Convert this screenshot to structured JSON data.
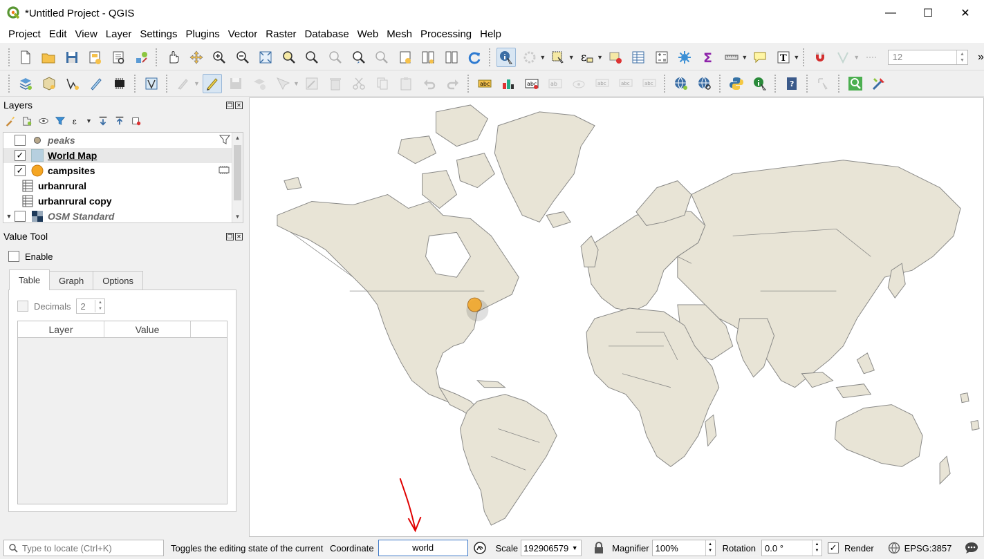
{
  "window": {
    "title": "*Untitled Project - QGIS",
    "minimize": "—",
    "maximize": "☐",
    "close": "✕"
  },
  "menubar": {
    "items": [
      "Project",
      "Edit",
      "View",
      "Layer",
      "Settings",
      "Plugins",
      "Vector",
      "Raster",
      "Database",
      "Web",
      "Mesh",
      "Processing",
      "Help"
    ]
  },
  "toolbar": {
    "font_size_value": "12",
    "overflow": "»"
  },
  "layers_panel": {
    "title": "Layers",
    "layers": [
      {
        "name": "peaks",
        "checked": false,
        "style": "italic",
        "icon": "point-icon"
      },
      {
        "name": "World Map",
        "checked": true,
        "style": "underline",
        "icon": "polygon-icon"
      },
      {
        "name": "campsites",
        "checked": true,
        "style": "normal",
        "icon": "orange-point-icon"
      },
      {
        "name": "urbanrural",
        "checked": null,
        "style": "normal",
        "icon": "table-icon"
      },
      {
        "name": "urbanrural copy",
        "checked": null,
        "style": "normal",
        "icon": "table-icon"
      },
      {
        "name": "OSM Standard",
        "checked": false,
        "style": "italic",
        "icon": "xyz-tile-icon"
      }
    ],
    "check_mark": "✓"
  },
  "value_tool": {
    "title": "Value Tool",
    "enable_label": "Enable",
    "tabs": [
      "Table",
      "Graph",
      "Options"
    ],
    "decimals_label": "Decimals",
    "decimals_value": "2",
    "columns": [
      "Layer",
      "Value"
    ]
  },
  "statusbar": {
    "locator_placeholder": "Type to locate (Ctrl+K)",
    "message": "Toggles the editing state of the current",
    "coordinate_label": "Coordinate",
    "coordinate_value": "world",
    "scale_label": "Scale",
    "scale_value": "192906579",
    "magnifier_label": "Magnifier",
    "magnifier_value": "100%",
    "rotation_label": "Rotation",
    "rotation_value": "0.0 °",
    "render_label": "Render",
    "crs": "EPSG:3857"
  },
  "colors": {
    "land": "#e8e4d6",
    "border": "#8a8a88",
    "campsite": "#f5a623",
    "annotation_arrow": "#e00000"
  }
}
